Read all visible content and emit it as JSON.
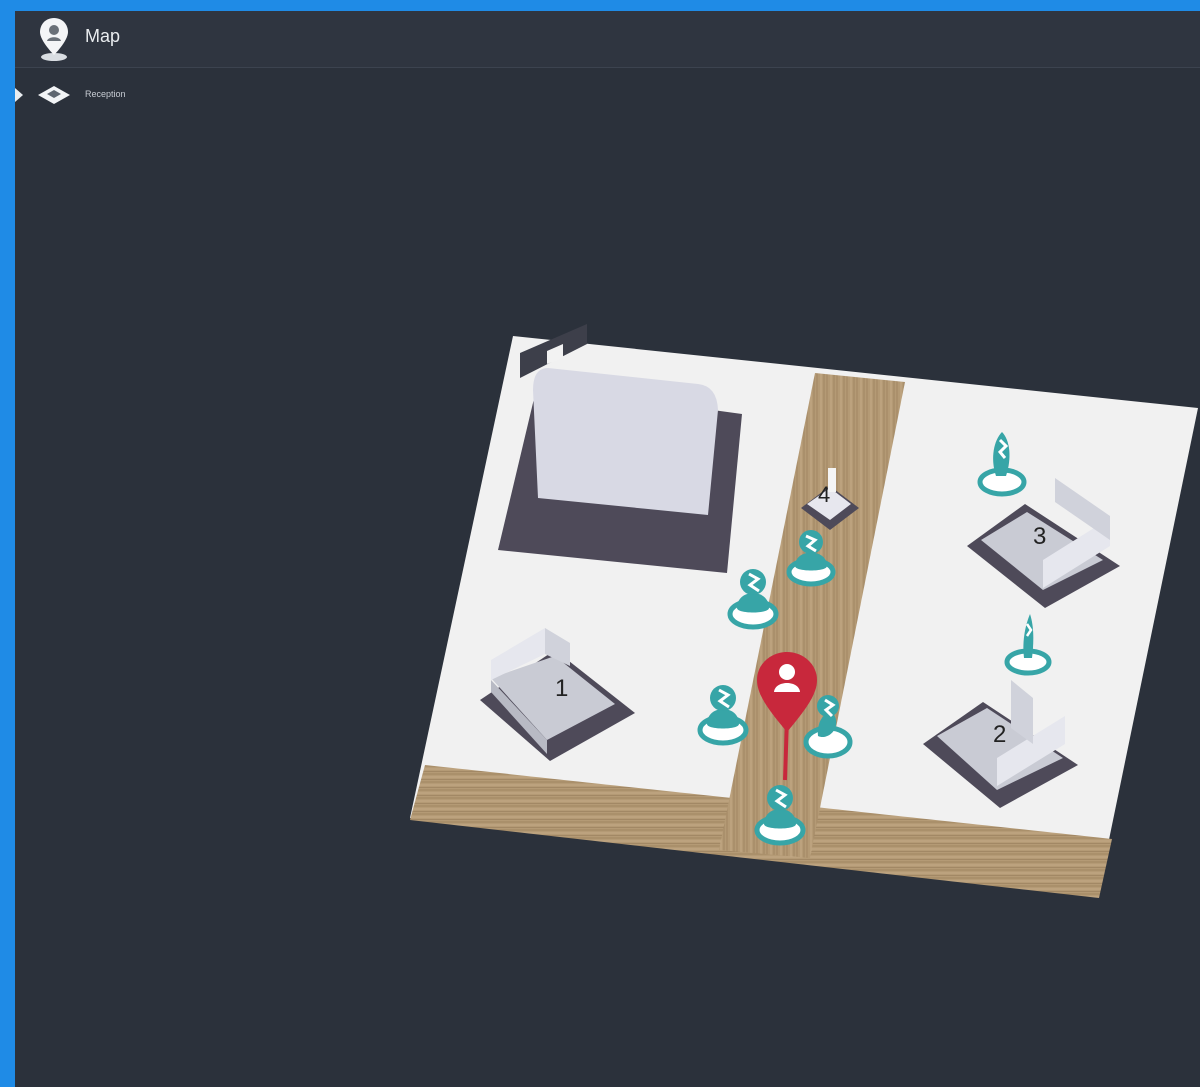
{
  "header": {
    "title": "Map",
    "icon": "map-pin-icon"
  },
  "tree": {
    "items": [
      {
        "label": "Reception",
        "icon": "floor-plan-icon",
        "expanded": false
      }
    ]
  },
  "map": {
    "desks": [
      {
        "id": "desk-1",
        "label": "1"
      },
      {
        "id": "desk-2",
        "label": "2"
      },
      {
        "id": "desk-3",
        "label": "3"
      },
      {
        "id": "desk-4",
        "label": "4"
      }
    ],
    "colors": {
      "floor": "#f1f1f1",
      "wood": "#b49a75",
      "desk_base": "#4e4a59",
      "person_marker": "#37a5a7",
      "location_pin": "#c8283c",
      "background": "#2b313b",
      "accent_frame": "#1f8be6"
    }
  }
}
